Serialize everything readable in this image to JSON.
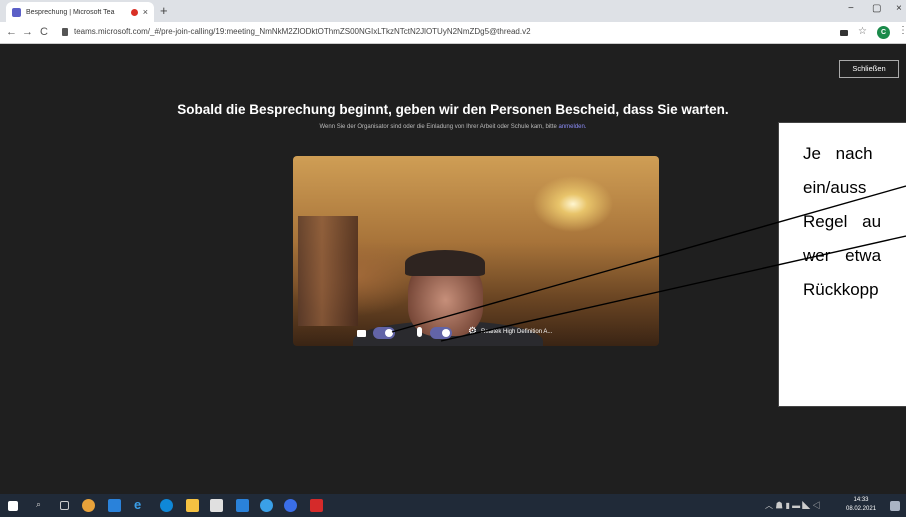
{
  "browser": {
    "tab_title": "Besprechung | Microsoft Tea",
    "tab_close": "×",
    "new_tab": "+",
    "back": "←",
    "forward": "→",
    "reload": "C",
    "url": "teams.microsoft.com/_#/pre-join-calling/19:meeting_NmNkM2ZlODktOThmZS00NGIxLTkzNTctN2JlOTUyN2NmZDg5@thread.v2",
    "profile_initial": "C",
    "minimize": "−",
    "maximize": "▢",
    "close": "×"
  },
  "teams": {
    "close_button": "Schließen",
    "headline": "Sobald die Besprechung beginnt, geben wir den Personen Bescheid, dass Sie warten.",
    "subline_text": "Wenn Sie der Organisator sind oder die Einladung von Ihrer Arbeit oder Schule kam, bitte ",
    "subline_link": "anmelden.",
    "audio_device": "Realtek High Definition A..."
  },
  "callout": {
    "lines": [
      "Je nach",
      "ein/auss",
      "Regel au",
      "wer etwa",
      "Rückkopp"
    ]
  },
  "taskbar": {
    "time": "14:33",
    "date": "08.02.2021"
  },
  "colors": {
    "teams_bg": "#1f1f1f",
    "toggle_accent": "#6264a7",
    "link": "#8b8cf7",
    "taskbar": "#202a38"
  }
}
